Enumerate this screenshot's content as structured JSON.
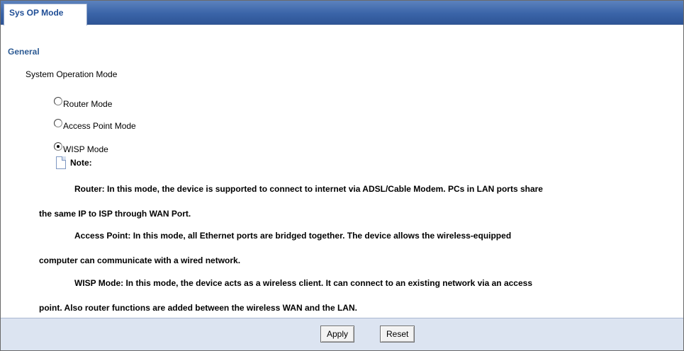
{
  "tabs": [
    {
      "label": "Sys OP Mode"
    }
  ],
  "section": {
    "title": "General"
  },
  "field": {
    "label": "System Operation Mode",
    "options": [
      {
        "label": "Router Mode",
        "checked": false
      },
      {
        "label": "Access Point Mode",
        "checked": false
      },
      {
        "label": "WISP Mode",
        "checked": true
      }
    ]
  },
  "note": {
    "heading": "Note:",
    "lines": [
      "Router: In this mode, the device is supported to connect to internet via ADSL/Cable Modem. PCs in LAN ports share",
      "the same IP to ISP through WAN Port.",
      "Access Point: In this mode, all Ethernet ports are bridged together. The device allows the wireless-equipped",
      "computer can communicate with a wired network.",
      "WISP Mode: In this mode, the device acts as a wireless client. It can connect to an existing network via an access",
      "point. Also router functions are added between the wireless WAN and the LAN."
    ]
  },
  "buttons": {
    "apply": "Apply",
    "reset": "Reset"
  },
  "colors": {
    "tab_bar": "#3a64a8",
    "section_title": "#2d5b94",
    "footer": "#dce4f1"
  },
  "icons": {
    "note": "document-icon"
  }
}
